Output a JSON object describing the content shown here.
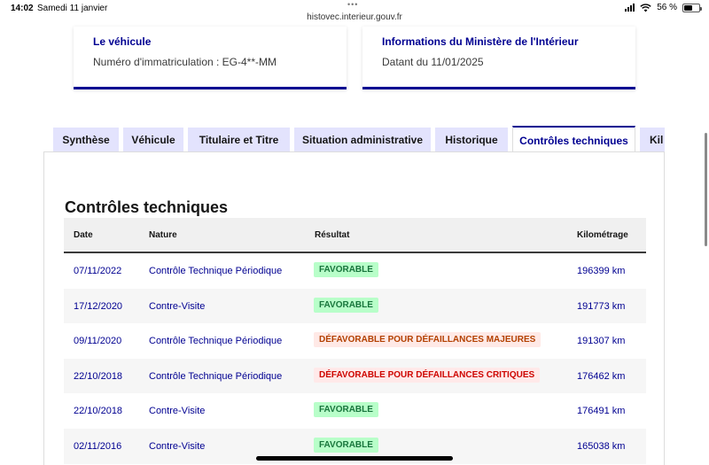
{
  "status_bar": {
    "time": "14:02",
    "date": "Samedi 11 janvier",
    "url": "histovec.interieur.gouv.fr",
    "battery": "56 %",
    "battery_level": 0.56
  },
  "cards": [
    {
      "title": "Le véhicule",
      "text": "Numéro d'immatriculation : EG-4**-MM"
    },
    {
      "title": "Informations du Ministère de l'Intérieur",
      "text": "Datant du 11/01/2025"
    }
  ],
  "tabs": [
    {
      "label": "Synthèse",
      "active": false
    },
    {
      "label": "Véhicule",
      "active": false
    },
    {
      "label": "Titulaire et Titre",
      "active": false
    },
    {
      "label": "Situation administrative",
      "active": false
    },
    {
      "label": "Historique",
      "active": false
    },
    {
      "label": "Contrôles techniques",
      "active": true
    },
    {
      "label": "Kil",
      "active": false
    }
  ],
  "section": {
    "title": "Contrôles techniques"
  },
  "table": {
    "headers": [
      "Date",
      "Nature",
      "Résultat",
      "Kilométrage"
    ],
    "rows": [
      {
        "date": "07/11/2022",
        "nature": "Contrôle Technique Périodique",
        "result": "FAVORABLE",
        "status": "ok",
        "km": "196399 km"
      },
      {
        "date": "17/12/2020",
        "nature": "Contre-Visite",
        "result": "FAVORABLE",
        "status": "ok",
        "km": "191773 km"
      },
      {
        "date": "09/11/2020",
        "nature": "Contrôle Technique Périodique",
        "result": "DÉFAVORABLE POUR DÉFAILLANCES MAJEURES",
        "status": "major",
        "km": "191307 km"
      },
      {
        "date": "22/10/2018",
        "nature": "Contrôle Technique Périodique",
        "result": "DÉFAVORABLE POUR DÉFAILLANCES CRITIQUES",
        "status": "critical",
        "km": "176462 km"
      },
      {
        "date": "22/10/2018",
        "nature": "Contre-Visite",
        "result": "FAVORABLE",
        "status": "ok",
        "km": "176491 km"
      },
      {
        "date": "02/11/2016",
        "nature": "Contre-Visite",
        "result": "FAVORABLE",
        "status": "ok",
        "km": "165038 km"
      }
    ]
  },
  "colors": {
    "primary": "#000091",
    "tab_background": "#e3e3fd",
    "success_bg": "#b8fec9",
    "success_text": "#18753c",
    "warning_bg": "#ffe9e6",
    "warning_text": "#b34000",
    "error_bg": "#ffe9e9",
    "error_text": "#ce0500"
  },
  "icons": [
    "more-dots-icon",
    "cellular-signal-icon",
    "wifi-icon",
    "battery-icon"
  ]
}
